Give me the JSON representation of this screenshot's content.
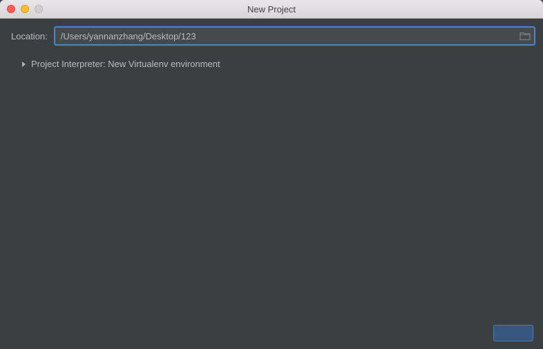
{
  "window": {
    "title": "New Project"
  },
  "location": {
    "label": "Location:",
    "value": "/Users/yannanzhang/Desktop/123"
  },
  "interpreter": {
    "label": "Project Interpreter: New Virtualenv environment"
  },
  "footer": {
    "create": ""
  },
  "colors": {
    "bg": "#3c3f41",
    "input_bg": "#45494a",
    "focus": "#4a88c7",
    "text": "#bbbbbb",
    "button": "#365880"
  }
}
